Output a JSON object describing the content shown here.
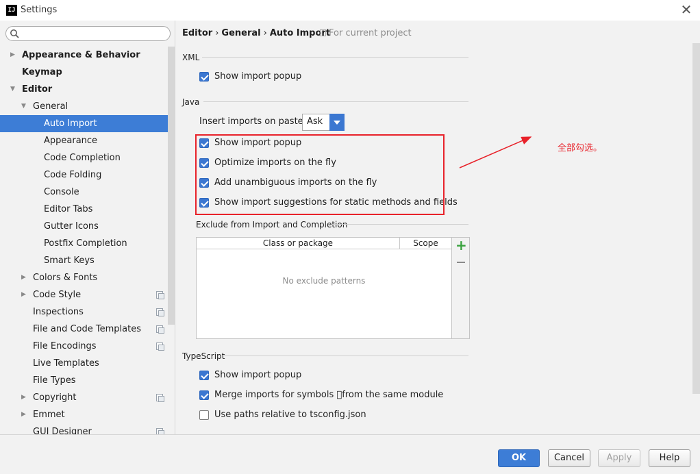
{
  "window": {
    "title": "Settings",
    "app_icon": "IJ",
    "close_glyph": "✕"
  },
  "sidebar": {
    "search_placeholder": "",
    "items": [
      {
        "label": "Appearance & Behavior",
        "arrow": "▶"
      },
      {
        "label": "Keymap"
      },
      {
        "label": "Editor",
        "arrow": "▼"
      },
      {
        "label": "General",
        "arrow": "▼"
      },
      {
        "label": "Auto Import"
      },
      {
        "label": "Appearance"
      },
      {
        "label": "Code Completion"
      },
      {
        "label": "Code Folding"
      },
      {
        "label": "Console"
      },
      {
        "label": "Editor Tabs"
      },
      {
        "label": "Gutter Icons"
      },
      {
        "label": "Postfix Completion"
      },
      {
        "label": "Smart Keys"
      },
      {
        "label": "Colors & Fonts",
        "arrow": "▶"
      },
      {
        "label": "Code Style",
        "arrow": "▶"
      },
      {
        "label": "Inspections"
      },
      {
        "label": "File and Code Templates"
      },
      {
        "label": "File Encodings"
      },
      {
        "label": "Live Templates"
      },
      {
        "label": "File Types"
      },
      {
        "label": "Copyright",
        "arrow": "▶"
      },
      {
        "label": "Emmet",
        "arrow": "▶"
      },
      {
        "label": "GUI Designer"
      }
    ]
  },
  "breadcrumb": {
    "part1": "Editor",
    "part2": "General",
    "part3": "Auto Import",
    "separator": "›",
    "scope": "For current project"
  },
  "xml": {
    "label": "XML",
    "show_popup": {
      "label": "Show import popup",
      "checked": true
    }
  },
  "java": {
    "label": "Java",
    "paste_label": "Insert imports on paste:",
    "paste_value": "Ask",
    "show_popup": {
      "label": "Show import popup",
      "checked": true
    },
    "optimize": {
      "label": "Optimize imports on the fly",
      "checked": true
    },
    "add_unambiguous": {
      "label": "Add unambiguous imports on the fly",
      "checked": true
    },
    "static_suggestions": {
      "label": "Show import suggestions for static methods and fields",
      "checked": true
    }
  },
  "exclude": {
    "label": "Exclude from Import and Completion",
    "col_class": "Class or package",
    "col_scope": "Scope",
    "empty_text": "No exclude patterns",
    "add_glyph": "+"
  },
  "typescript": {
    "label": "TypeScript",
    "show_popup": {
      "label": "Show import popup",
      "checked": true
    },
    "merge": {
      "label": "Merge imports for symbols \u0000from the same module",
      "checked": true
    },
    "relative": {
      "label": "Use paths relative to tsconfig.json",
      "checked": false
    }
  },
  "annotation": {
    "text": "全部勾选。",
    "color": "#e8222a"
  },
  "buttons": {
    "ok": "OK",
    "cancel": "Cancel",
    "apply": "Apply",
    "help": "Help"
  },
  "colors": {
    "selection": "#3d7dd6",
    "checkbox": "#3b77d1",
    "annotation": "#e8222a"
  }
}
